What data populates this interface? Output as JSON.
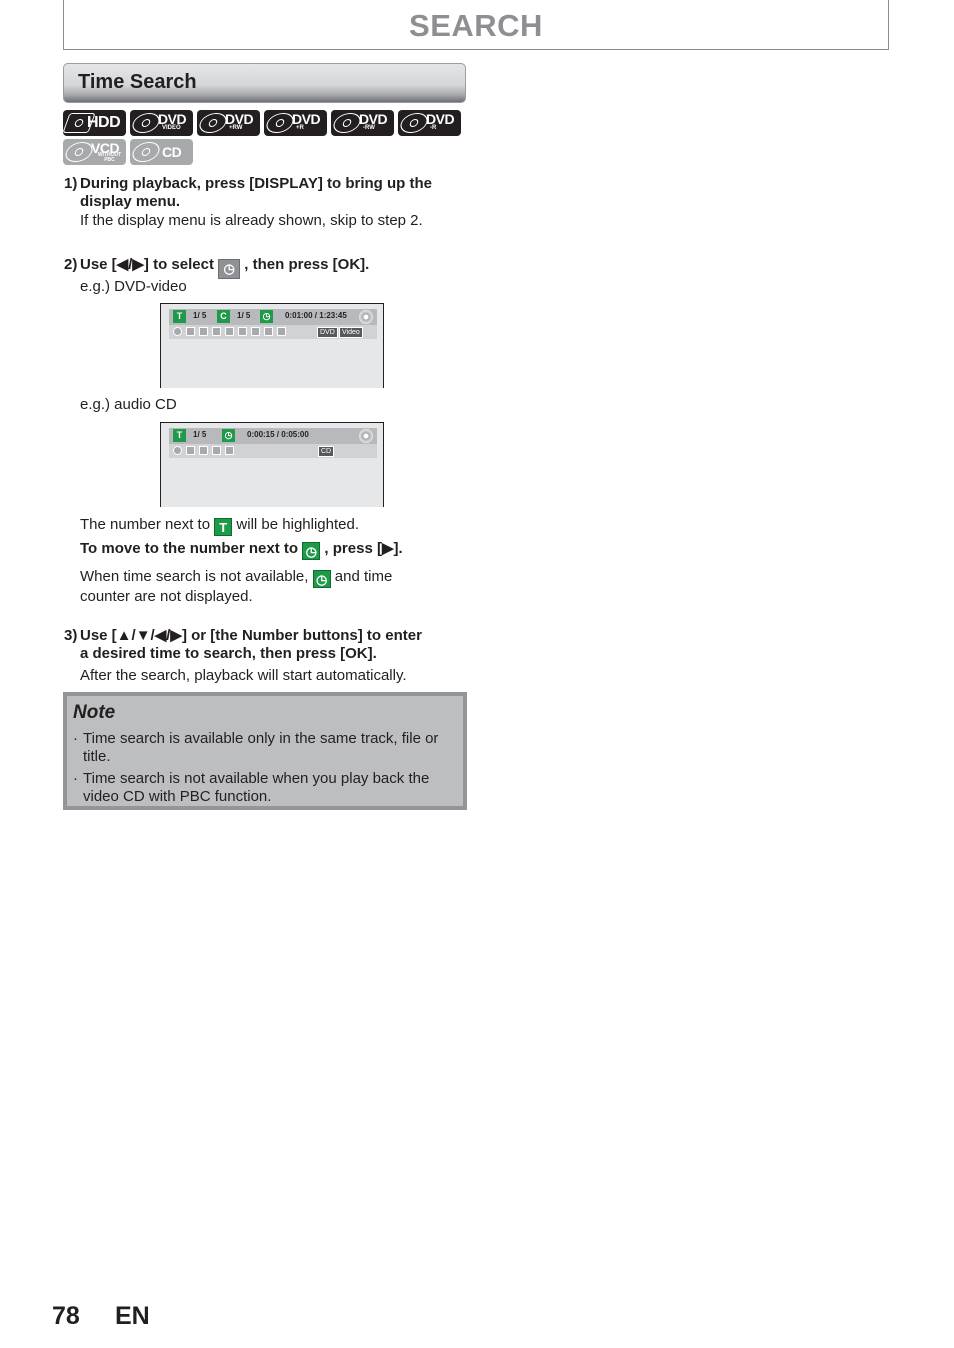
{
  "page": {
    "title": "SEARCH",
    "section_title": "Time Search",
    "page_number": "78",
    "language": "EN"
  },
  "media_icons": [
    {
      "name": "HDD",
      "sub": ""
    },
    {
      "name": "DVD",
      "sub": "VIDEO"
    },
    {
      "name": "DVD",
      "sub": "+RW"
    },
    {
      "name": "DVD",
      "sub": "+R"
    },
    {
      "name": "DVD",
      "sub": "-RW"
    },
    {
      "name": "DVD",
      "sub": "-R"
    },
    {
      "name": "VCD",
      "sub": "WITHOUT PBC"
    },
    {
      "name": "CD",
      "sub": ""
    }
  ],
  "steps": [
    {
      "number": "1)",
      "heading_line1": "During playback, press [DISPLAY] to bring up the",
      "heading_line2": "display menu.",
      "body": "If the display menu is already shown, skip to step 2."
    },
    {
      "number": "2)",
      "heading_pre": "Use [◀/▶] to select",
      "heading_post": ", then press [OK].",
      "example_dvd": "e.g.) DVD-video",
      "example_cd": "e.g.) audio CD",
      "highlight_pre": "The number next to",
      "highlight_post": "will be highlighted.",
      "move_pre": "To move to the number next to",
      "move_post": ", press [▶].",
      "unavail_pre": "When time search is not available,",
      "unavail_post": "and time",
      "unavail_line2": "counter are not displayed."
    },
    {
      "number": "3)",
      "heading_line1": "Use [▲/▼/◀/▶] or [the Number buttons] to enter",
      "heading_line2": "a desired time to search, then press [OK].",
      "body": "After the search, playback will start automatically."
    }
  ],
  "osd_dvd": {
    "title_icon": "T",
    "title_value": "1/  5",
    "chapter_icon": "C",
    "chapter_value": "1/  5",
    "time": "0:01:00 / 1:23:45",
    "tags": [
      "DVD",
      "Video"
    ]
  },
  "osd_cd": {
    "title_icon": "T",
    "title_value": "1/  5",
    "time": "0:00:15 / 0:05:00",
    "tags": [
      "CD"
    ]
  },
  "icons": {
    "title_letter": "T",
    "clock_glyph": "◷",
    "search_glyph": "⌕"
  },
  "note": {
    "title": "Note",
    "items": [
      "Time search is available only in the same track, file or",
      "title.",
      "Time search is not available when you play back the",
      "video CD with PBC function."
    ]
  }
}
